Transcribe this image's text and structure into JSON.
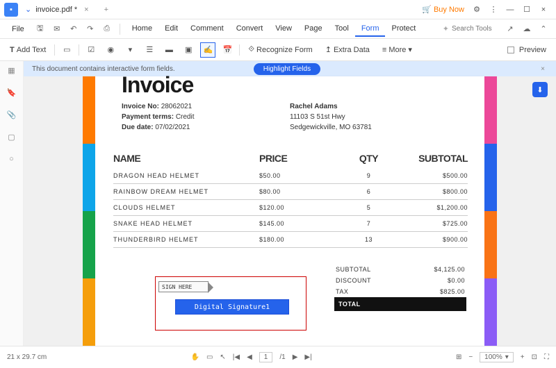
{
  "title": {
    "filename": "invoice.pdf *"
  },
  "titlebar": {
    "buynow": "Buy Now"
  },
  "menubar": {
    "file": "File",
    "items": [
      "Home",
      "Edit",
      "Comment",
      "Convert",
      "View",
      "Page",
      "Tool",
      "Form",
      "Protect"
    ],
    "active_index": 7,
    "search_placeholder": "Search Tools"
  },
  "toolbar": {
    "add_text": "Add Text",
    "recognize_form": "Recognize Form",
    "extra_data": "Extra Data",
    "more": "More",
    "preview": "Preview"
  },
  "banner": {
    "message": "This document contains interactive form fields.",
    "button": "Highlight Fields"
  },
  "invoice": {
    "heading": "Invoice",
    "labels": {
      "no": "Invoice No:",
      "terms": "Payment terms:",
      "due": "Due date:"
    },
    "no": "28062021",
    "terms": "Credit",
    "due": "07/02/2021",
    "customer": {
      "name": "Rachel Adams",
      "street": "11103 S 51st Hwy",
      "city": "Sedgewickville, MO 63781"
    },
    "headers": {
      "name": "NAME",
      "price": "PRICE",
      "qty": "QTY",
      "subtotal": "SUBTOTAL"
    },
    "rows": [
      {
        "name": "DRAGON HEAD HELMET",
        "price": "$50.00",
        "qty": "9",
        "subtotal": "$500.00"
      },
      {
        "name": "RAINBOW DREAM HELMET",
        "price": "$80.00",
        "qty": "6",
        "subtotal": "$800.00"
      },
      {
        "name": "CLOUDS HELMET",
        "price": "$120.00",
        "qty": "5",
        "subtotal": "$1,200.00"
      },
      {
        "name": "SNAKE HEAD HELMET",
        "price": "$145.00",
        "qty": "7",
        "subtotal": "$725.00"
      },
      {
        "name": "THUNDERBIRD HELMET",
        "price": "$180.00",
        "qty": "13",
        "subtotal": "$900.00"
      }
    ],
    "totals": {
      "subtotal_label": "SUBTOTAL",
      "subtotal": "$4,125.00",
      "discount_label": "DISCOUNT",
      "discount": "$0.00",
      "tax_label": "TAX",
      "tax": "$825.00",
      "total_label": "TOTAL"
    },
    "signature": {
      "sign_here": "SIGN HERE",
      "field_label": "Digital Signature1"
    }
  },
  "status": {
    "dimensions": "21 x 29.7 cm",
    "page_current": "1",
    "page_total": "/1",
    "zoom": "100%"
  }
}
